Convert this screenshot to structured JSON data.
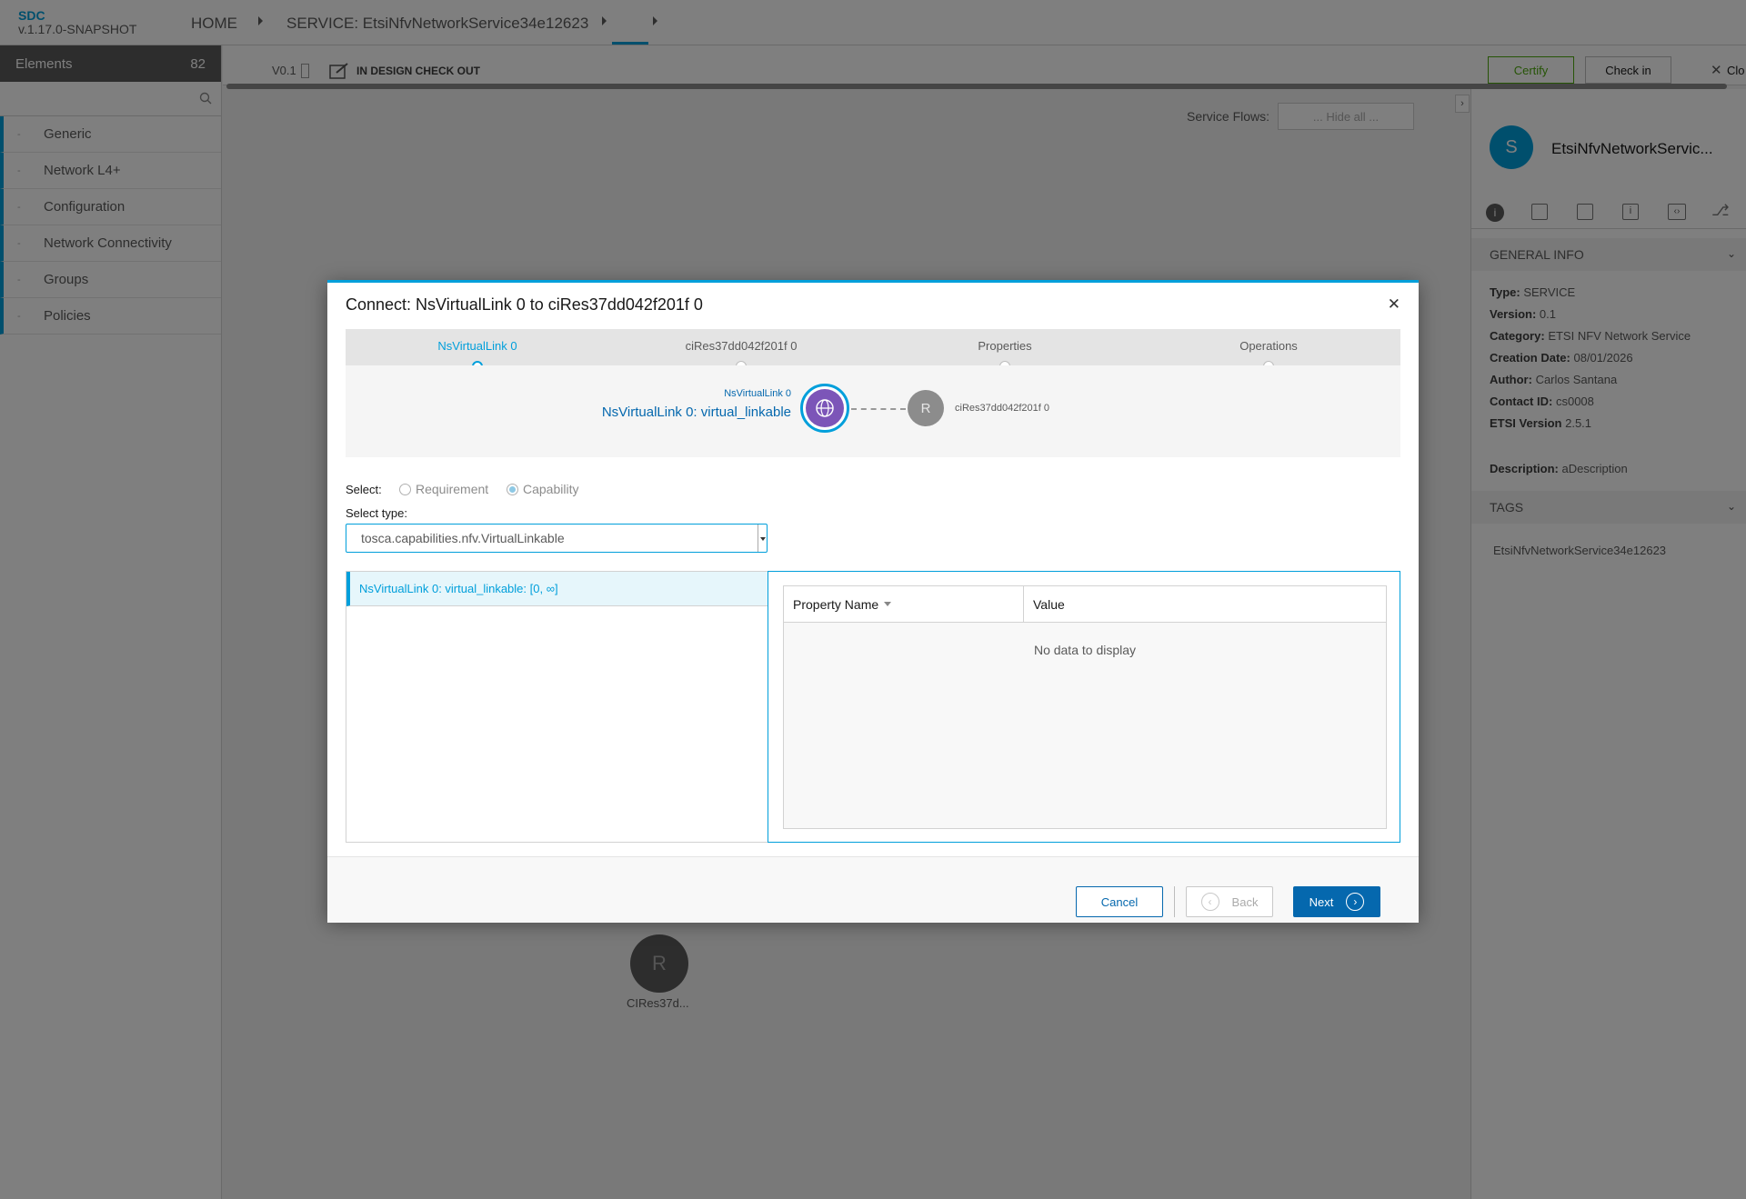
{
  "app": {
    "name": "SDC",
    "version": "v.1.17.0-SNAPSHOT"
  },
  "breadcrumb": {
    "home": "HOME",
    "service": "SERVICE: EtsiNfvNetworkService34e12623"
  },
  "sidebar": {
    "title": "Elements",
    "count": "82",
    "items": [
      {
        "label": "Generic"
      },
      {
        "label": "Network L4+"
      },
      {
        "label": "Configuration"
      },
      {
        "label": "Network Connectivity"
      },
      {
        "label": "Groups"
      },
      {
        "label": "Policies"
      }
    ]
  },
  "toolbar": {
    "version": "V0.1",
    "status": "IN DESIGN CHECK OUT",
    "certify": "Certify",
    "checkin": "Check in",
    "close": "Clo"
  },
  "canvas": {
    "service_flows_label": "Service Flows:",
    "service_flows_value": "... Hide all ...",
    "node_letter": "R",
    "node_label": "CIRes37d..."
  },
  "right_panel": {
    "avatar_letter": "S",
    "title": "EtsiNfvNetworkServic...",
    "general_info": "GENERAL INFO",
    "type_label": "Type:",
    "type_value": "SERVICE",
    "version_label": "Version:",
    "version_value": "0.1",
    "category_label": "Category:",
    "category_value": "ETSI NFV Network Service",
    "creation_label": "Creation Date:",
    "creation_value": "08/01/2026",
    "author_label": "Author:",
    "author_value": "Carlos Santana",
    "contact_label": "Contact ID:",
    "contact_value": "cs0008",
    "etsi_label": "ETSI Version",
    "etsi_value": "2.5.1",
    "desc_label": "Description:",
    "desc_value": "aDescription",
    "tags": "TAGS",
    "tag_value": "EtsiNfvNetworkService34e12623"
  },
  "modal": {
    "title": "Connect: NsVirtualLink 0 to ciRes37dd042f201f 0",
    "steps": [
      {
        "label": "NsVirtualLink 0"
      },
      {
        "label": "ciRes37dd042f201f 0"
      },
      {
        "label": "Properties"
      },
      {
        "label": "Operations"
      }
    ],
    "diagram": {
      "from_small": "NsVirtualLink 0",
      "from_big": "NsVirtualLink 0: virtual_linkable",
      "to_letter": "R",
      "to_label": "ciRes37dd042f201f 0"
    },
    "select_label": "Select:",
    "radio_requirement": "Requirement",
    "radio_capability": "Capability",
    "select_type_label": "Select type:",
    "select_type_value": "tosca.capabilities.nfv.VirtualLinkable",
    "list_item": "NsVirtualLink 0: virtual_linkable: [0, ∞]",
    "table": {
      "col_name": "Property Name",
      "col_value": "Value",
      "empty": "No data to display"
    },
    "buttons": {
      "cancel": "Cancel",
      "back": "Back",
      "next": "Next"
    }
  }
}
